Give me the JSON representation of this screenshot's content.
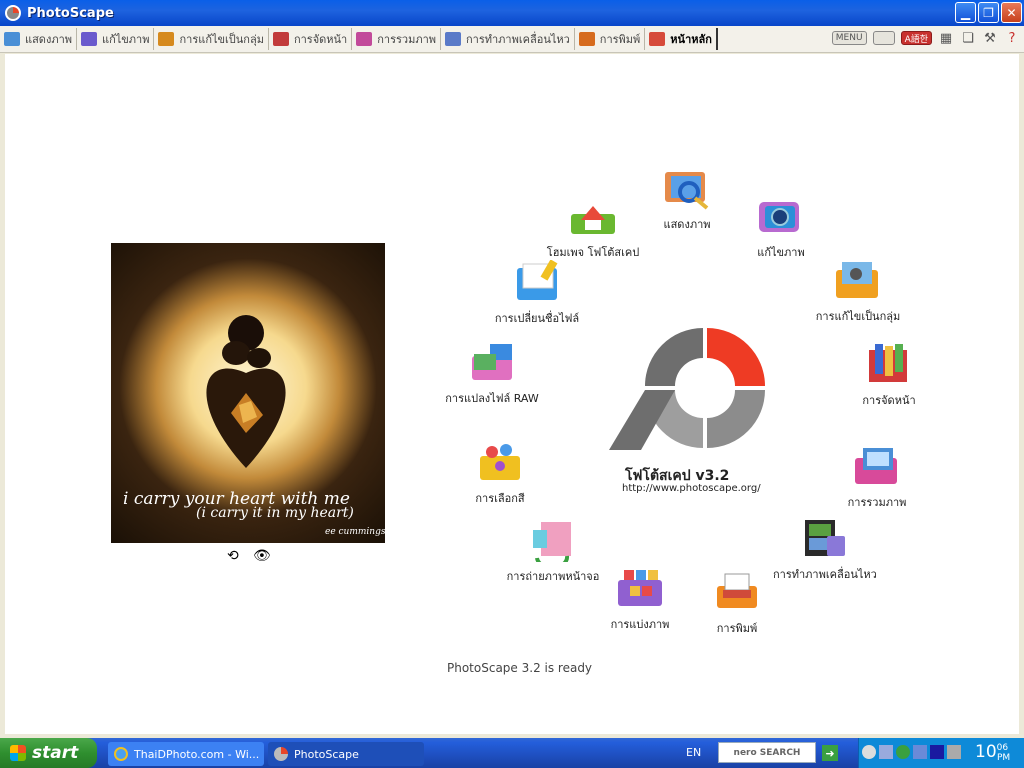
{
  "window": {
    "title": "PhotoScape"
  },
  "tabs": [
    {
      "label": "แสดงภาพ",
      "color": "#4a8fd6"
    },
    {
      "label": "แก้ไขภาพ",
      "color": "#6a5acd"
    },
    {
      "label": "การแก้ไขเป็นกลุ่ม",
      "color": "#d68a1e"
    },
    {
      "label": "การจัดหน้า",
      "color": "#c23b3b"
    },
    {
      "label": "การรวมภาพ",
      "color": "#c24a9a"
    },
    {
      "label": "การทำภาพเคลื่อนไหว",
      "color": "#5a7ac8"
    },
    {
      "label": "การพิมพ์",
      "color": "#d66b1e"
    },
    {
      "label": "หน้าหลัก",
      "color": "#d64a3a"
    }
  ],
  "toolbar_right": {
    "menu_label": "MENU",
    "lang_label": "A語한"
  },
  "photo": {
    "line1": "i carry your heart with me",
    "line2": "(i carry it in my heart)",
    "signature": "ee cummings"
  },
  "logo": {
    "title": "โฟโต้สเคป v3.2",
    "url": "http://www.photoscape.org/"
  },
  "menu": {
    "viewer": "แสดงภาพ",
    "editor": "แก้ไขภาพ",
    "batch": "การแก้ไขเป็นกลุ่ม",
    "page": "การจัดหน้า",
    "combine": "การรวมภาพ",
    "gif": "การทำภาพเคลื่อนไหว",
    "print": "การพิมพ์",
    "splitter": "การแบ่งภาพ",
    "screen": "การถ่ายภาพหน้าจอ",
    "color": "การเลือกสี",
    "raw": "การแปลงไฟล์ RAW",
    "rename": "การเปลี่ยนชื่อไฟล์",
    "home": "โฮมเพจ โฟโต้สเคป"
  },
  "status": "PhotoScape 3.2 is ready",
  "taskbar": {
    "start": "start",
    "items": [
      "ThaiDPhoto.com - Wi...",
      "PhotoScape"
    ],
    "lang": "EN",
    "nero": "nero SEARCH",
    "clock_hour": "10",
    "clock_min": "06",
    "clock_ampm": "PM"
  }
}
